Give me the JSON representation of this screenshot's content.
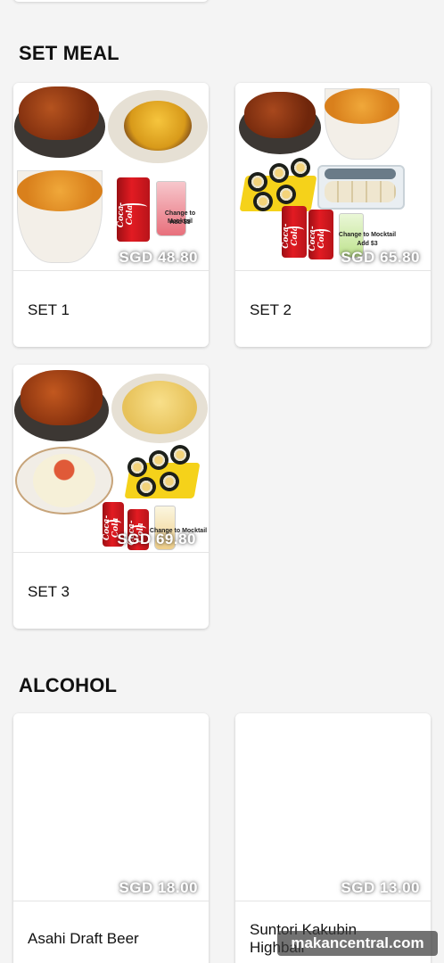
{
  "sections": [
    {
      "title": "SET MEAL",
      "items": [
        {
          "name": "SET 1",
          "price": "SGD 48.80",
          "image_note": [
            "Change to Mocktail",
            "Add $3"
          ]
        },
        {
          "name": "SET 2",
          "price": "SGD 65.80",
          "image_note": [
            "Change to Mocktail",
            "Add $3"
          ]
        },
        {
          "name": "SET 3",
          "price": "SGD 69.80",
          "image_note": [
            "Change to Mocktail"
          ]
        }
      ]
    },
    {
      "title": "ALCOHOL",
      "items": [
        {
          "name": "Asahi Draft Beer",
          "price": "SGD 18.00"
        },
        {
          "name": "Suntori Kakubin Highball",
          "price": "SGD 13.00"
        }
      ]
    }
  ],
  "brand": {
    "can_text": "Coca-Cola"
  },
  "watermark": "makancentral.com"
}
